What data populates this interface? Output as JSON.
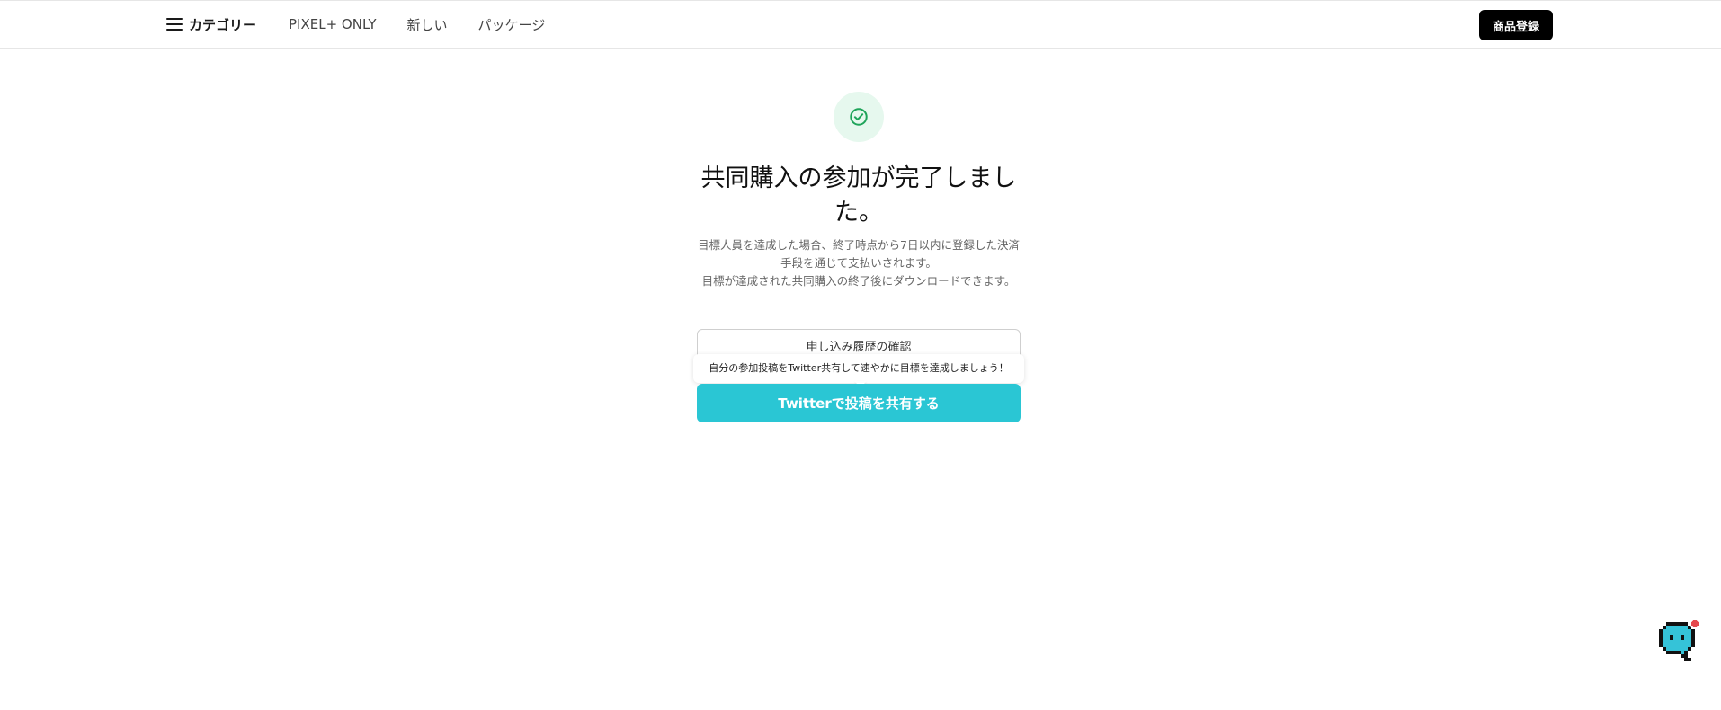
{
  "nav": {
    "category_label": "カテゴリー",
    "links": [
      "PIXEL+ ONLY",
      "新しい",
      "パッケージ"
    ],
    "register_label": "商品登録"
  },
  "main": {
    "title": "共同購入の参加が完了しました。",
    "description_line1": "目標人員を達成した場合、終了時点から7日以内に登録した決済手段を通じて支払いされます。",
    "description_line2": "目標が達成された共同購入の終了後にダウンロードできます。",
    "history_button_label": "申し込み履歴の確認",
    "tooltip_text": "自分の参加投稿をTwitter共有して速やかに目標を達成しましょう！",
    "share_button_label": "Twitterで投稿を共有する"
  },
  "icons": {
    "menu": "hamburger-icon",
    "success": "check-circle-icon",
    "chat": "chat-bubble-icon"
  },
  "colors": {
    "accent": "#2ac6d4",
    "success_green": "#1fa45a",
    "success_bg": "#e6f8ee",
    "chat_body": "#35c3d8",
    "notification_dot": "#e5484d"
  }
}
